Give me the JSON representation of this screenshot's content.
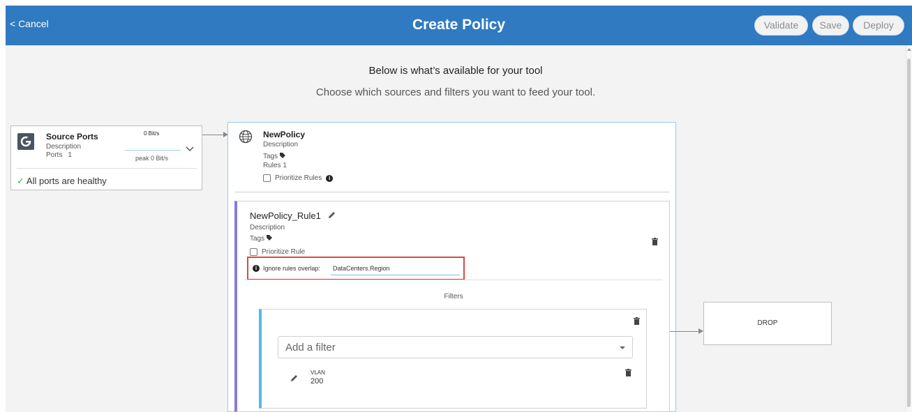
{
  "header": {
    "cancel_label": "< Cancel",
    "title": "Create Policy",
    "validate_label": "Validate",
    "save_label": "Save",
    "deploy_label": "Deploy",
    "background_color": "#2f7ac1"
  },
  "intro": {
    "heading": "Below is what’s available for your tool",
    "subheading": "Choose which sources and filters you want to feed your tool."
  },
  "source": {
    "title": "Source Ports",
    "description": "Description",
    "ports_label": "Ports",
    "ports_count": "1",
    "rate": "0 Bit/s",
    "peak": "peak 0 Bit/s",
    "health": "All ports are healthy"
  },
  "policy": {
    "name": "NewPolicy",
    "description": "Description",
    "tags_label": "Tags",
    "rules_label": "Rules 1",
    "prioritize_label": "Prioritize Rules"
  },
  "rule": {
    "name": "NewPolicy_Rule1",
    "description": "Description",
    "tags_label": "Tags",
    "prioritize_label": "Prioritize Rule",
    "overlap_label": "Ignore rules overlap:",
    "overlap_value": "DataCenters.Region",
    "filters_title": "Filters",
    "accent_color": "#8a7bd1"
  },
  "filter": {
    "add_placeholder": "Add a filter",
    "item_name": "VLAN",
    "item_value": "200",
    "accent_color": "#56b8e7"
  },
  "drop": {
    "label": "DROP"
  },
  "highlight_color": "#e0463c"
}
